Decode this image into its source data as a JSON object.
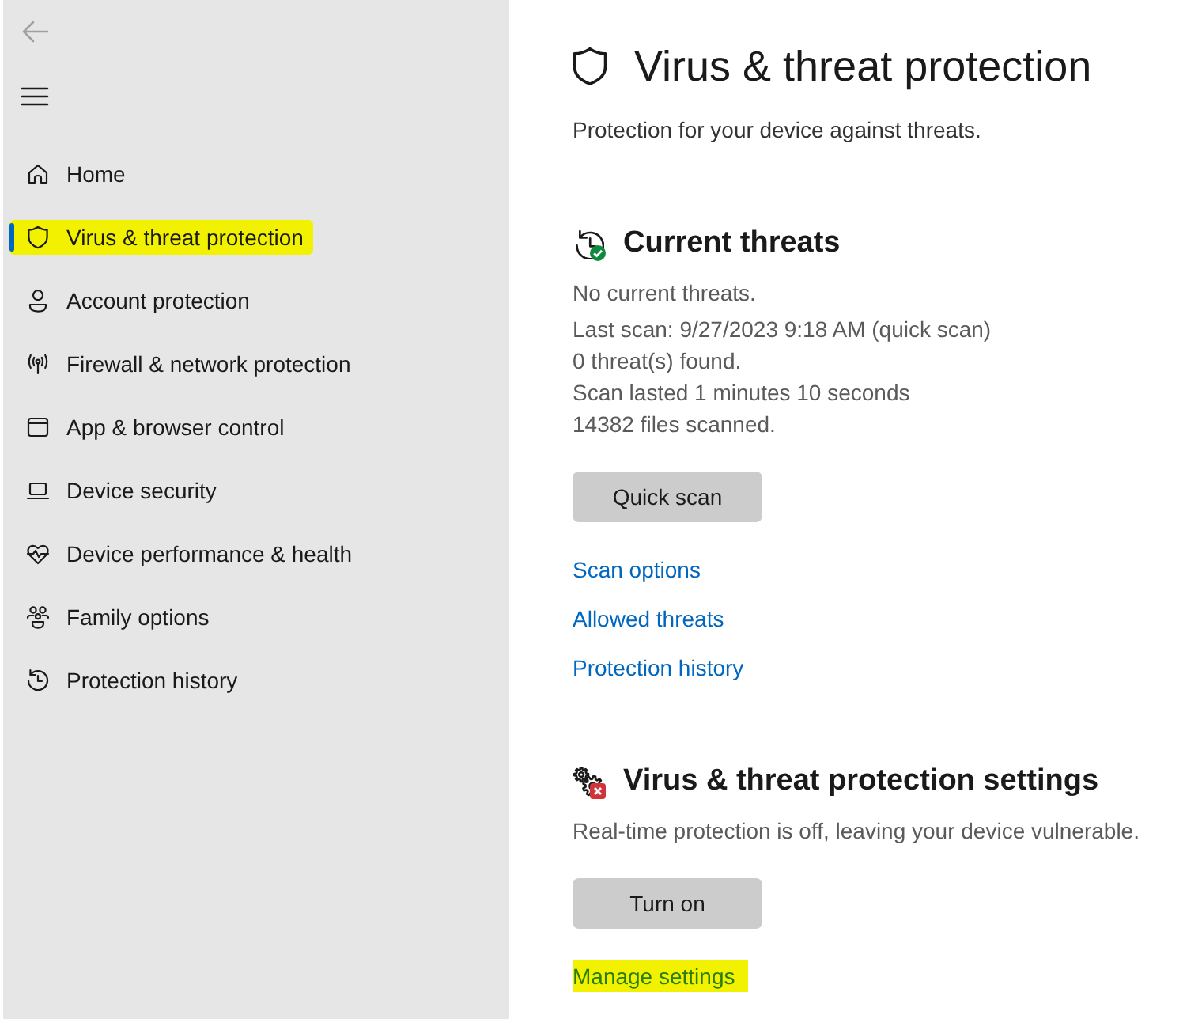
{
  "back_button": {
    "disabled": true
  },
  "sidebar": {
    "items": [
      {
        "label": "Home",
        "selected": false,
        "highlighted": false
      },
      {
        "label": "Virus & threat protection",
        "selected": true,
        "highlighted": true
      },
      {
        "label": "Account protection",
        "selected": false,
        "highlighted": false
      },
      {
        "label": "Firewall & network protection",
        "selected": false,
        "highlighted": false
      },
      {
        "label": "App & browser control",
        "selected": false,
        "highlighted": false
      },
      {
        "label": "Device security",
        "selected": false,
        "highlighted": false
      },
      {
        "label": "Device performance & health",
        "selected": false,
        "highlighted": false
      },
      {
        "label": "Family options",
        "selected": false,
        "highlighted": false
      },
      {
        "label": "Protection history",
        "selected": false,
        "highlighted": false
      }
    ]
  },
  "page": {
    "title": "Virus & threat protection",
    "subtitle": "Protection for your device against threats."
  },
  "sections": [
    {
      "kind": "threats",
      "alert": false,
      "heading": "Current threats",
      "summary": "No current threats.",
      "details": [
        "Last scan: 9/27/2023 9:18 AM (quick scan)",
        "0 threat(s) found.",
        "Scan lasted 1 minutes 10 seconds",
        "14382 files scanned."
      ],
      "button": "Quick scan",
      "links": [
        {
          "label": "Scan options",
          "highlighted": false
        },
        {
          "label": "Allowed threats",
          "highlighted": false
        },
        {
          "label": "Protection history",
          "highlighted": false
        }
      ]
    },
    {
      "kind": "settings",
      "alert": true,
      "heading": "Virus & threat protection settings",
      "summary": "Real-time protection is off, leaving your device vulnerable.",
      "button": "Turn on",
      "links": [
        {
          "label": "Manage settings",
          "highlighted": true
        }
      ]
    }
  ]
}
